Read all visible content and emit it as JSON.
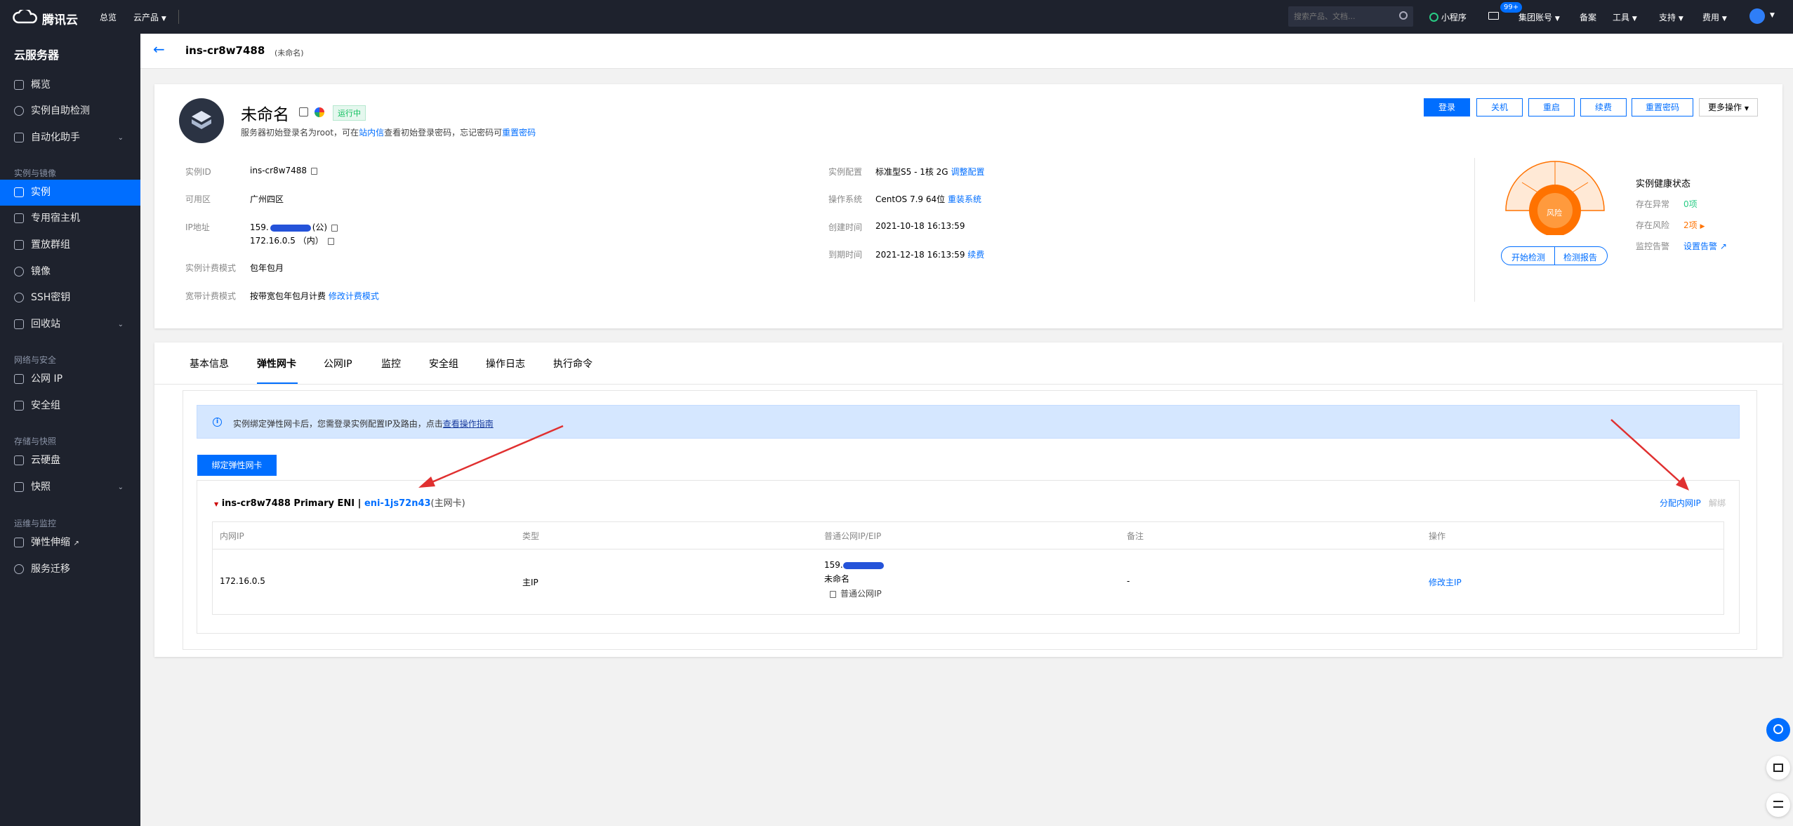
{
  "topbar": {
    "logo": "腾讯云",
    "nav": [
      "总览",
      "云产品"
    ],
    "search_placeholder": "搜索产品、文档...",
    "miniapp": "小程序",
    "msg_badge": "99+",
    "account": "集团账号",
    "filing": "备案",
    "tools": "工具",
    "support": "支持",
    "fees": "费用"
  },
  "sidebar": {
    "title": "云服务器",
    "items": [
      {
        "label": "概览"
      },
      {
        "label": "实例自助检测"
      },
      {
        "label": "自动化助手"
      }
    ],
    "group_instance": "实例与镜像",
    "instance_items": [
      {
        "label": "实例"
      },
      {
        "label": "专用宿主机"
      },
      {
        "label": "置放群组"
      },
      {
        "label": "镜像"
      },
      {
        "label": "SSH密钥"
      },
      {
        "label": "回收站"
      }
    ],
    "group_network": "网络与安全",
    "network_items": [
      {
        "label": "公网 IP"
      },
      {
        "label": "安全组"
      }
    ],
    "group_storage": "存储与快照",
    "storage_items": [
      {
        "label": "云硬盘"
      },
      {
        "label": "快照"
      }
    ],
    "group_ops": "运维与监控",
    "ops_items": [
      {
        "label": "弹性伸缩"
      },
      {
        "label": "服务迁移"
      }
    ]
  },
  "header": {
    "instance_id": "ins-cr8w7488",
    "instance_name": "(未命名)"
  },
  "summary": {
    "name": "未命名",
    "status": "运行中",
    "hint_prefix": "服务器初始登录名为root，可在",
    "hint_link1": "站内信",
    "hint_mid": "查看初始登录密码，忘记密码可",
    "hint_link2": "重置密码",
    "actions": [
      "登录",
      "关机",
      "重启",
      "续费",
      "重置密码",
      "更多操作"
    ],
    "left_fields": [
      {
        "label": "实例ID",
        "value": "ins-cr8w7488"
      },
      {
        "label": "可用区",
        "value": "广州四区"
      },
      {
        "label": "IP地址",
        "value": "159.",
        "suffix": "(公)"
      },
      {
        "label": "",
        "value": "172.16.0.5 （内）"
      },
      {
        "label": "实例计费模式",
        "value": "包年包月"
      },
      {
        "label": "宽带计费模式",
        "value": "按带宽包年包月计费",
        "link": "修改计费模式"
      }
    ],
    "right_fields": [
      {
        "label": "实例配置",
        "value": "标准型S5 - 1核 2G",
        "link": "调整配置"
      },
      {
        "label": "操作系统",
        "value": "CentOS 7.9 64位",
        "link": "重装系统"
      },
      {
        "label": "创建时间",
        "value": "2021-10-18 16:13:59"
      },
      {
        "label": "到期时间",
        "value": "2021-12-18 16:13:59",
        "link": "续费"
      }
    ],
    "health": {
      "gauge_label": "风险",
      "btn_check": "开始检测",
      "btn_report": "检测报告",
      "title": "实例健康状态",
      "rows": [
        {
          "label": "存在异常",
          "value": "0项"
        },
        {
          "label": "存在风险",
          "value": "2项"
        },
        {
          "label": "监控告警",
          "value": "设置告警"
        }
      ],
      "colors": {
        "ok": "#29cc85",
        "risk": "#ff7200"
      }
    }
  },
  "tabs": [
    "基本信息",
    "弹性网卡",
    "公网IP",
    "监控",
    "安全组",
    "操作日志",
    "执行命令"
  ],
  "eni": {
    "notice_prefix": "实例绑定弹性网卡后，您需登录实例配置IP及路由，点击",
    "notice_link": "查看操作指南",
    "bind_button": "绑定弹性网卡",
    "eni_title_prefix": "ins-cr8w7488 Primary ENI | ",
    "eni_id": "eni-1js72n43",
    "eni_suffix": "(主网卡)",
    "assign_link": "分配内网IP",
    "unbind_link": "解绑",
    "columns": [
      "内网IP",
      "类型",
      "普通公网IP/EIP",
      "备注",
      "操作"
    ],
    "row": {
      "private_ip": "172.16.0.5",
      "type": "主IP",
      "public_ip": "159.",
      "public_name": "未命名",
      "public_type": "普通公网IP",
      "remark": "-",
      "action": "修改主IP"
    }
  }
}
